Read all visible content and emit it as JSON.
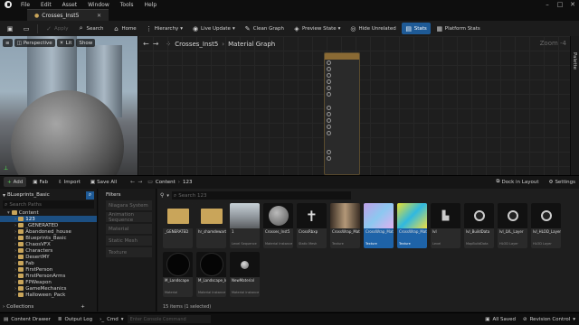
{
  "menubar": {
    "items": [
      "File",
      "Edit",
      "Asset",
      "Window",
      "Tools",
      "Help"
    ]
  },
  "tab": {
    "name": "Crosses_Inst5"
  },
  "toolbar": {
    "apply": "Apply",
    "search": "Search",
    "home": "Home",
    "hierarchy": "Hierarchy",
    "live_update": "Live Update",
    "clean_graph": "Clean Graph",
    "preview_state": "Preview State",
    "hide_unrelated": "Hide Unrelated",
    "stats": "Stats",
    "platform_stats": "Platform Stats"
  },
  "viewport": {
    "perspective": "Perspective",
    "lit": "Lit",
    "show": "Show"
  },
  "graph": {
    "breadcrumb_root": "Crosses_Inst5",
    "breadcrumb_sep": "›",
    "breadcrumb_leaf": "Material Graph",
    "zoom": "Zoom -4",
    "palette_label": "Palette"
  },
  "content_browser": {
    "add": "Add",
    "fab": "Fab",
    "import": "Import",
    "save_all": "Save All",
    "path": [
      "Content",
      "123"
    ],
    "dock": "Dock in Layout",
    "settings": "Settings",
    "sources_title": "BLueprints_Basic",
    "search_paths_placeholder": "Search Paths",
    "search_assets_placeholder": "Search 123",
    "filters_title": "Filters",
    "filters": [
      "Niagara System",
      "Animation Sequence",
      "Material",
      "Static Mesh",
      "Texture"
    ],
    "tree": [
      {
        "label": "Content",
        "level": 0
      },
      {
        "label": "123",
        "level": 1,
        "selected": true
      },
      {
        "label": "_GENERATED",
        "level": 1
      },
      {
        "label": "Abandoned_house",
        "level": 1
      },
      {
        "label": "Blueprints_Basic",
        "level": 1
      },
      {
        "label": "ChaosVFX",
        "level": 1
      },
      {
        "label": "Characters",
        "level": 1
      },
      {
        "label": "DesertMY",
        "level": 1
      },
      {
        "label": "Fab",
        "level": 1
      },
      {
        "label": "FirstPerson",
        "level": 1
      },
      {
        "label": "FirstPersonArms",
        "level": 1
      },
      {
        "label": "FPWeapon",
        "level": 1
      },
      {
        "label": "GameMechanics",
        "level": 1
      },
      {
        "label": "Halloween_Pack",
        "level": 1
      }
    ],
    "collections": "Collections",
    "item_count": "15 items (1 selected)",
    "assets": [
      {
        "label": "_GENERATED",
        "type": "",
        "kind": "folder"
      },
      {
        "label": "hr_shamdewarts",
        "type": "",
        "kind": "folder"
      },
      {
        "label": "1",
        "type": "Level Sequence",
        "kind": "level"
      },
      {
        "label": "Crosses_Inst5",
        "type": "Material Instance",
        "kind": "sphere"
      },
      {
        "label": "CrossRbxp",
        "type": "Static Mesh",
        "kind": "cross"
      },
      {
        "label": "CrossWrap_Material_Base",
        "type": "Texture",
        "kind": "room"
      },
      {
        "label": "CrossWrap_Material",
        "type": "Texture",
        "kind": "normal",
        "selected": true
      },
      {
        "label": "CrossWrap_Material_Base",
        "type": "Texture",
        "kind": "yellow",
        "selected": true
      },
      {
        "label": "lvl",
        "type": "Level",
        "kind": "dark"
      },
      {
        "label": "lvl_BuildData",
        "type": "MapBuildData",
        "kind": "orb"
      },
      {
        "label": "lvl_LVL_Layer",
        "type": "HLOD Layer",
        "kind": "orb"
      },
      {
        "label": "lvl_HLOD_Layer_Merged",
        "type": "HLOD Layer",
        "kind": "orb"
      },
      {
        "label": "M_Landscape",
        "type": "Material",
        "kind": "black"
      },
      {
        "label": "M_Landscape_Inst",
        "type": "Material Instance",
        "kind": "black"
      },
      {
        "label": "NewMaterial",
        "type": "Material Instance",
        "kind": "small"
      }
    ]
  },
  "statusbar": {
    "content_drawer": "Content Drawer",
    "output_log": "Output Log",
    "cmd": "Cmd",
    "console_placeholder": "Enter Console Command",
    "all_saved": "All Saved",
    "revision_control": "Revision Control"
  },
  "colors": {
    "accent": "#1e5a96",
    "selection": "#1e63a8",
    "folder": "#c9a55a",
    "node_header": "#8a6a34"
  }
}
